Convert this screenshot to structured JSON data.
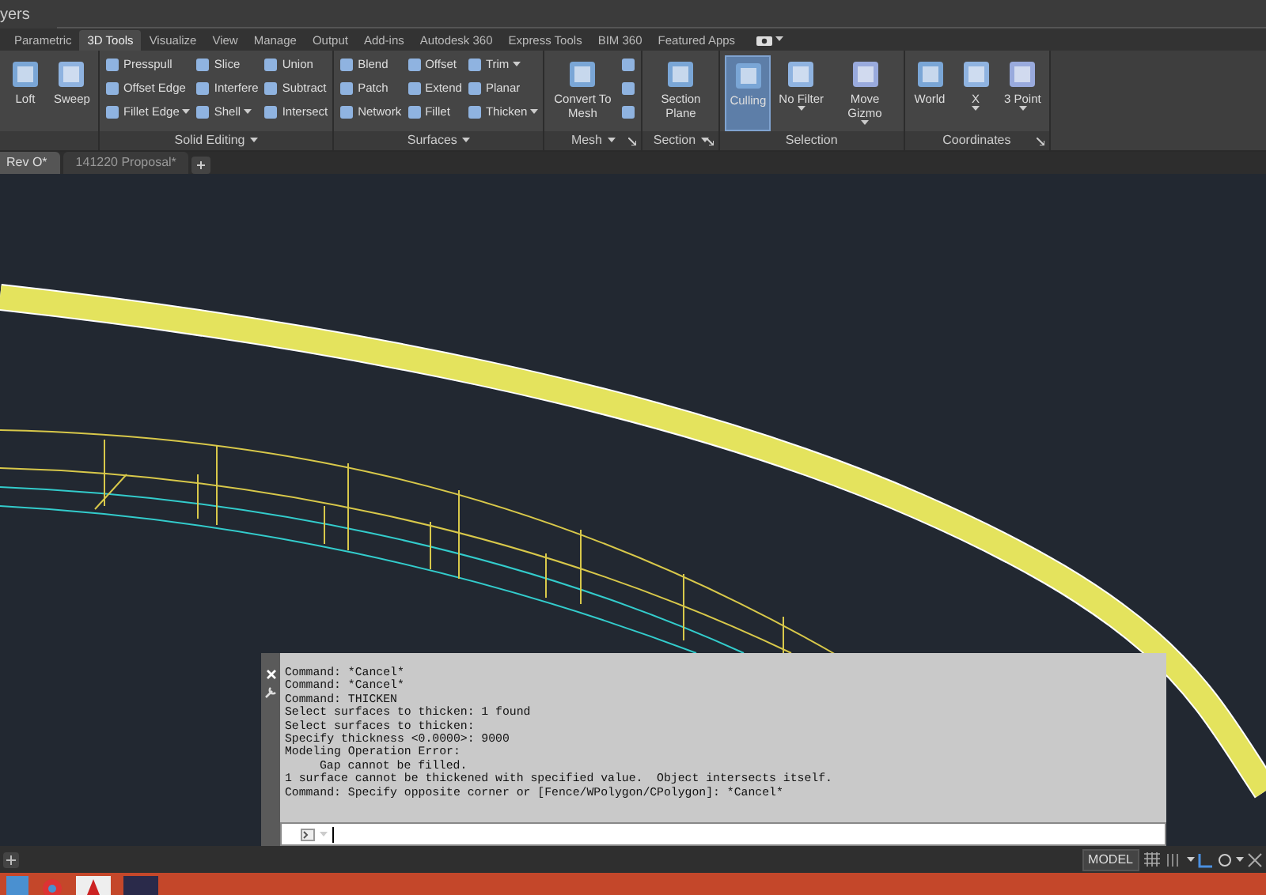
{
  "window": {
    "title": "yers"
  },
  "tabs": [
    {
      "label": "Parametric",
      "selected": false
    },
    {
      "label": "3D Tools",
      "selected": true
    },
    {
      "label": "Visualize",
      "selected": false
    },
    {
      "label": "View",
      "selected": false
    },
    {
      "label": "Manage",
      "selected": false
    },
    {
      "label": "Output",
      "selected": false
    },
    {
      "label": "Add-ins",
      "selected": false
    },
    {
      "label": "Autodesk 360",
      "selected": false
    },
    {
      "label": "Express Tools",
      "selected": false
    },
    {
      "label": "BIM 360",
      "selected": false
    },
    {
      "label": "Featured Apps",
      "selected": false
    }
  ],
  "ribbon_panels": [
    {
      "columns": [
        {
          "kind": "large",
          "label": "Loft",
          "has_menu": false,
          "selected": false
        },
        {
          "kind": "large",
          "label": "Sweep",
          "has_menu": false,
          "selected": false
        }
      ]
    },
    {
      "title": "Solid Editing",
      "has_menu": true,
      "launcher": false,
      "columns": [
        {
          "kind": "stack",
          "items": [
            {
              "label": "Presspull",
              "has_menu": false
            },
            {
              "label": "Offset Edge",
              "has_menu": false
            },
            {
              "label": "Fillet Edge",
              "has_menu": true
            }
          ]
        },
        {
          "kind": "stack",
          "items": [
            {
              "label": "Slice",
              "has_menu": false
            },
            {
              "label": "Interfere",
              "has_menu": false
            },
            {
              "label": "Shell",
              "has_menu": true
            }
          ]
        },
        {
          "kind": "stack",
          "items": [
            {
              "label": "Union",
              "has_menu": false
            },
            {
              "label": "Subtract",
              "has_menu": false
            },
            {
              "label": "Intersect",
              "has_menu": false
            }
          ]
        }
      ]
    },
    {
      "title": "Surfaces",
      "has_menu": true,
      "launcher": false,
      "columns": [
        {
          "kind": "stack",
          "items": [
            {
              "label": "Blend",
              "has_menu": false
            },
            {
              "label": "Patch",
              "has_menu": false
            },
            {
              "label": "Network",
              "has_menu": false
            }
          ]
        },
        {
          "kind": "stack",
          "items": [
            {
              "label": "Offset",
              "has_menu": false
            },
            {
              "label": "Extend",
              "has_menu": false
            },
            {
              "label": "Fillet",
              "has_menu": false
            }
          ]
        },
        {
          "kind": "stack",
          "items": [
            {
              "label": "Trim",
              "has_menu": true
            },
            {
              "label": "Planar",
              "has_menu": false
            },
            {
              "label": "Thicken",
              "has_menu": true
            }
          ]
        }
      ]
    },
    {
      "title": "Mesh",
      "has_menu": true,
      "launcher": true,
      "columns": [
        {
          "kind": "large",
          "label": "Convert To Mesh",
          "has_menu": false,
          "selected": false
        },
        {
          "kind": "stack",
          "items": [
            {
              "has_menu": false
            },
            {
              "has_menu": false
            },
            {
              "has_menu": false
            }
          ]
        }
      ]
    },
    {
      "title": "Section",
      "has_menu": true,
      "launcher": true,
      "columns": [
        {
          "kind": "large",
          "label": "Section Plane",
          "has_menu": false,
          "selected": false
        }
      ]
    },
    {
      "title": "Selection",
      "has_menu": false,
      "launcher": false,
      "columns": [
        {
          "kind": "large",
          "label": "Culling",
          "has_menu": false,
          "selected": true
        },
        {
          "kind": "large",
          "label": "No Filter",
          "has_menu": true,
          "selected": false
        },
        {
          "kind": "large",
          "label": "Move Gizmo",
          "has_menu": true,
          "selected": false
        }
      ]
    },
    {
      "title": "Coordinates",
      "has_menu": false,
      "launcher": true,
      "columns": [
        {
          "kind": "large",
          "label": "World",
          "has_menu": false,
          "selected": false
        },
        {
          "kind": "large",
          "label": "X",
          "has_menu": true,
          "selected": false
        },
        {
          "kind": "large",
          "label": "3 Point",
          "has_menu": true,
          "selected": false
        }
      ]
    }
  ],
  "doc_tabs": [
    {
      "label": "Rev O*",
      "selected": true
    },
    {
      "label": "141220 Proposal*",
      "selected": false
    }
  ],
  "command_history": [
    {
      "text": "Command: *Cancel*",
      "indented": false
    },
    {
      "text": "Command: *Cancel*",
      "indented": false
    },
    {
      "text": "Command: THICKEN",
      "indented": false
    },
    {
      "text": "Select surfaces to thicken: 1 found",
      "indented": false
    },
    {
      "text": "Select surfaces to thicken:",
      "indented": false
    },
    {
      "text": "Specify thickness <0.0000>: 9000",
      "indented": false
    },
    {
      "text": "Modeling Operation Error:",
      "indented": false
    },
    {
      "text": "Gap cannot be filled.",
      "indented": true
    },
    {
      "text": "1 surface cannot be thickened with specified value.  Object intersects itself.",
      "indented": false
    },
    {
      "text": "Command: Specify opposite corner or [Fence/WPolygon/CPolygon]: *Cancel*",
      "indented": false
    }
  ],
  "status_bar": {
    "model_label": "MODEL"
  }
}
